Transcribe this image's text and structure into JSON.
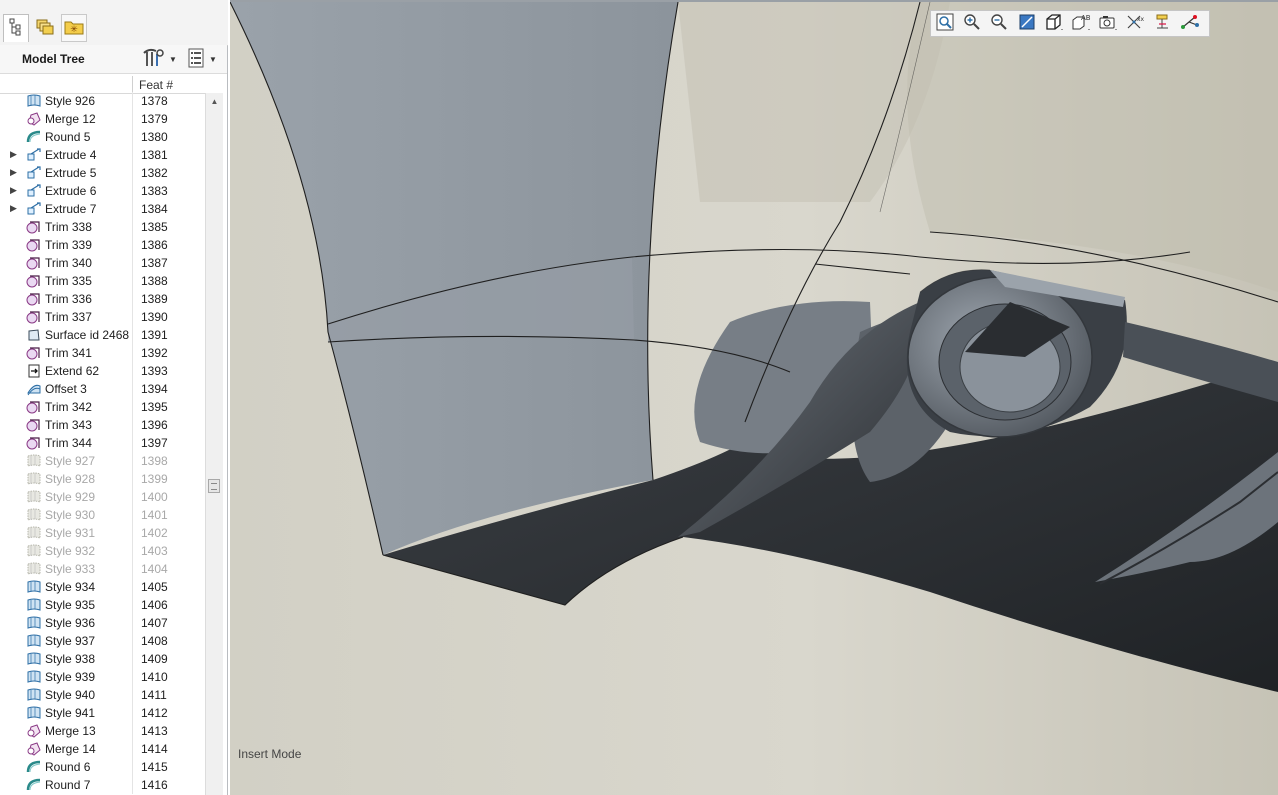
{
  "left_panel": {
    "tabs": [
      {
        "icon": "model-tree-tab-icon"
      },
      {
        "icon": "layer-tree-tab-icon"
      },
      {
        "icon": "favorites-folder-icon"
      }
    ],
    "title": "Model Tree",
    "settings_icon": "tree-settings-icon",
    "show_icon": "tree-columns-icon",
    "column_header": "Feat #"
  },
  "tree_rows": [
    {
      "label": "Style 926",
      "feat": "1378",
      "icon": "style",
      "expandable": false,
      "suppressed": false
    },
    {
      "label": "Merge 12",
      "feat": "1379",
      "icon": "merge",
      "expandable": false,
      "suppressed": false
    },
    {
      "label": "Round 5",
      "feat": "1380",
      "icon": "round",
      "expandable": false,
      "suppressed": false
    },
    {
      "label": "Extrude 4",
      "feat": "1381",
      "icon": "extrude",
      "expandable": true,
      "suppressed": false
    },
    {
      "label": "Extrude 5",
      "feat": "1382",
      "icon": "extrude",
      "expandable": true,
      "suppressed": false
    },
    {
      "label": "Extrude 6",
      "feat": "1383",
      "icon": "extrude",
      "expandable": true,
      "suppressed": false
    },
    {
      "label": "Extrude 7",
      "feat": "1384",
      "icon": "extrude",
      "expandable": true,
      "suppressed": false
    },
    {
      "label": "Trim 338",
      "feat": "1385",
      "icon": "trim",
      "expandable": false,
      "suppressed": false
    },
    {
      "label": "Trim 339",
      "feat": "1386",
      "icon": "trim",
      "expandable": false,
      "suppressed": false
    },
    {
      "label": "Trim 340",
      "feat": "1387",
      "icon": "trim",
      "expandable": false,
      "suppressed": false
    },
    {
      "label": "Trim 335",
      "feat": "1388",
      "icon": "trim",
      "expandable": false,
      "suppressed": false
    },
    {
      "label": "Trim 336",
      "feat": "1389",
      "icon": "trim",
      "expandable": false,
      "suppressed": false
    },
    {
      "label": "Trim 337",
      "feat": "1390",
      "icon": "trim",
      "expandable": false,
      "suppressed": false
    },
    {
      "label": "Surface id 2468",
      "feat": "1391",
      "icon": "surface",
      "expandable": false,
      "suppressed": false
    },
    {
      "label": "Trim 341",
      "feat": "1392",
      "icon": "trim",
      "expandable": false,
      "suppressed": false
    },
    {
      "label": "Extend 62",
      "feat": "1393",
      "icon": "extend",
      "expandable": false,
      "suppressed": false
    },
    {
      "label": "Offset 3",
      "feat": "1394",
      "icon": "offset",
      "expandable": false,
      "suppressed": false
    },
    {
      "label": "Trim 342",
      "feat": "1395",
      "icon": "trim",
      "expandable": false,
      "suppressed": false
    },
    {
      "label": "Trim 343",
      "feat": "1396",
      "icon": "trim",
      "expandable": false,
      "suppressed": false
    },
    {
      "label": "Trim 344",
      "feat": "1397",
      "icon": "trim",
      "expandable": false,
      "suppressed": false
    },
    {
      "label": "Style 927",
      "feat": "1398",
      "icon": "style",
      "expandable": false,
      "suppressed": true
    },
    {
      "label": "Style 928",
      "feat": "1399",
      "icon": "style",
      "expandable": false,
      "suppressed": true
    },
    {
      "label": "Style 929",
      "feat": "1400",
      "icon": "style",
      "expandable": false,
      "suppressed": true
    },
    {
      "label": "Style 930",
      "feat": "1401",
      "icon": "style",
      "expandable": false,
      "suppressed": true
    },
    {
      "label": "Style 931",
      "feat": "1402",
      "icon": "style",
      "expandable": false,
      "suppressed": true
    },
    {
      "label": "Style 932",
      "feat": "1403",
      "icon": "style",
      "expandable": false,
      "suppressed": true
    },
    {
      "label": "Style 933",
      "feat": "1404",
      "icon": "style",
      "expandable": false,
      "suppressed": true
    },
    {
      "label": "Style 934",
      "feat": "1405",
      "icon": "style",
      "expandable": false,
      "suppressed": false
    },
    {
      "label": "Style 935",
      "feat": "1406",
      "icon": "style",
      "expandable": false,
      "suppressed": false
    },
    {
      "label": "Style 936",
      "feat": "1407",
      "icon": "style",
      "expandable": false,
      "suppressed": false
    },
    {
      "label": "Style 937",
      "feat": "1408",
      "icon": "style",
      "expandable": false,
      "suppressed": false
    },
    {
      "label": "Style 938",
      "feat": "1409",
      "icon": "style",
      "expandable": false,
      "suppressed": false
    },
    {
      "label": "Style 939",
      "feat": "1410",
      "icon": "style",
      "expandable": false,
      "suppressed": false
    },
    {
      "label": "Style 940",
      "feat": "1411",
      "icon": "style",
      "expandable": false,
      "suppressed": false
    },
    {
      "label": "Style 941",
      "feat": "1412",
      "icon": "style",
      "expandable": false,
      "suppressed": false
    },
    {
      "label": "Merge 13",
      "feat": "1413",
      "icon": "merge",
      "expandable": false,
      "suppressed": false
    },
    {
      "label": "Merge 14",
      "feat": "1414",
      "icon": "merge",
      "expandable": false,
      "suppressed": false
    },
    {
      "label": "Round 6",
      "feat": "1415",
      "icon": "round",
      "expandable": false,
      "suppressed": false
    },
    {
      "label": "Round 7",
      "feat": "1416",
      "icon": "round",
      "expandable": false,
      "suppressed": false
    }
  ],
  "view_toolbar": [
    "refit-icon",
    "zoom-in-icon",
    "zoom-out-icon",
    "repaint-icon",
    "display-style-icon",
    "saved-orientations-icon",
    "saved-views-icon",
    "datum-display-icon",
    "annotation-display-icon",
    "spin-center-icon"
  ],
  "status": {
    "mode": "Insert Mode"
  },
  "colors": {
    "viewport_background": "#d8d6cc",
    "surface_light": "#8f979f",
    "surface_dark": "#2d3034",
    "suppressed_text": "#a8a8a8"
  }
}
